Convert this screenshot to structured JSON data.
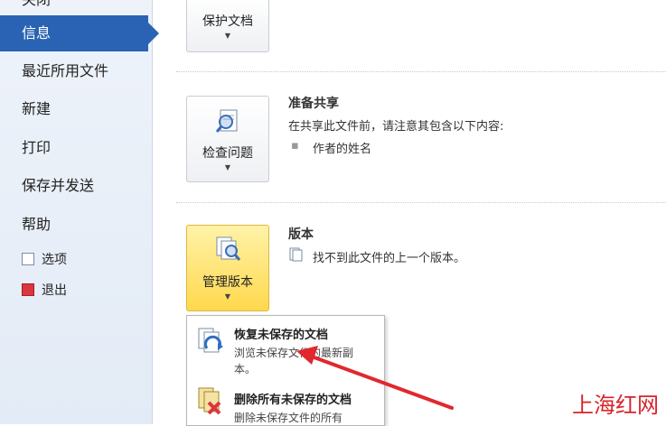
{
  "sidebar": {
    "items": [
      {
        "label": "关闭"
      },
      {
        "label": "信息"
      },
      {
        "label": "最近所用文件"
      },
      {
        "label": "新建"
      },
      {
        "label": "打印"
      },
      {
        "label": "保存并发送"
      },
      {
        "label": "帮助"
      }
    ],
    "small_items": [
      {
        "label": "选项",
        "icon": "options-icon"
      },
      {
        "label": "退出",
        "icon": "exit-icon"
      }
    ]
  },
  "protect": {
    "button_label": "保护文档"
  },
  "share": {
    "button_label": "检查问题",
    "title": "准备共享",
    "desc": "在共享此文件前，请注意其包含以下内容:",
    "bullet": "作者的姓名"
  },
  "versions": {
    "button_label": "管理版本",
    "title": "版本",
    "desc": "找不到此文件的上一个版本。"
  },
  "dropdown": {
    "items": [
      {
        "title": "恢复未保存的文档",
        "desc": "浏览未保存文件的最新副本。"
      },
      {
        "title": "删除所有未保存的文档",
        "desc": "删除未保存文件的所有"
      }
    ]
  },
  "watermark": "上海红网",
  "colors": {
    "active": "#2a63b3",
    "highlight": "#ffd84d",
    "arrow": "#e0282e"
  }
}
